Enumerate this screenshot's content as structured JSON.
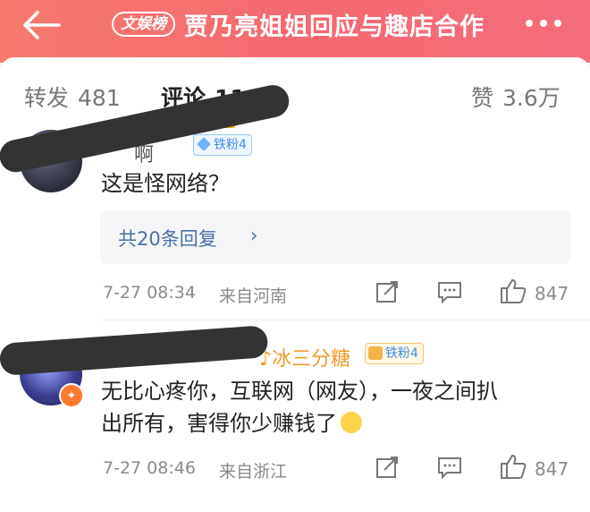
{
  "header": {
    "badge": "文娱榜",
    "title": "贾乃亮姐姐回应与趣店合作"
  },
  "tabs": [
    {
      "label": "转发",
      "count": "481"
    },
    {
      "label": "评论",
      "count": "1161"
    },
    {
      "label": "赞",
      "count": "3.6万"
    }
  ],
  "comments": [
    {
      "username_visible": "啊",
      "fan_badge": "铁粉4",
      "text": "这是怪网络？",
      "replies_label": "共20条回复",
      "time": "7-27  08:34",
      "location": "来自河南",
      "likes": "847"
    },
    {
      "username_visible": "冰三分糖",
      "fan_badge": "铁粉4",
      "text_line1": "无比心疼你，互联网（网友），一夜之间扒",
      "text_line2": "出所有，害得你少赚钱了",
      "time": "7-27  08:46",
      "location": "来自浙江",
      "likes": "847"
    }
  ],
  "colors": {
    "header_gradient_start": "#f77a6d",
    "header_gradient_end": "#f46d7d",
    "tab_underline": "#f9a21c",
    "reply_link": "#4a6fa8",
    "orange_name": "#f09a2b"
  }
}
